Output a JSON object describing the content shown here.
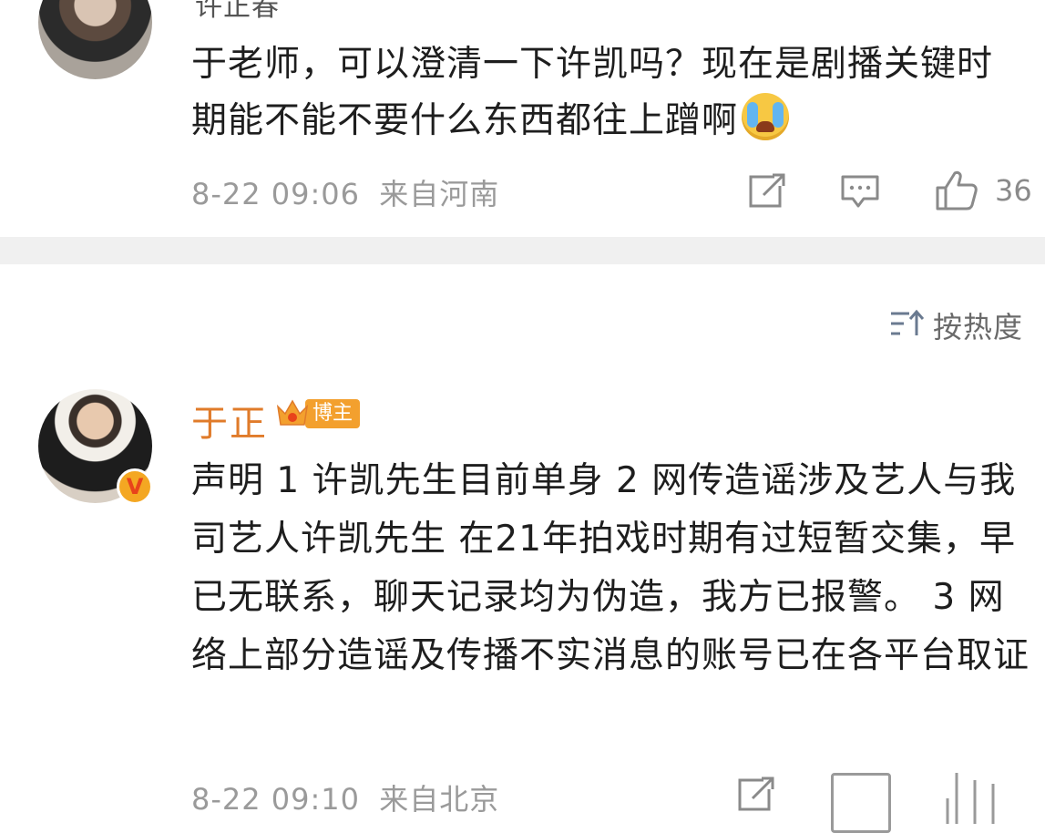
{
  "comment1": {
    "username": "许正春",
    "text": "于老师，可以澄清一下许凯吗？现在是剧播关键时期能不能不要什么东西都往上蹭啊",
    "emoji": "crying-face-icon",
    "time": "8-22 09:06",
    "location": "来自河南",
    "likes": "36"
  },
  "sort": {
    "label": "按热度"
  },
  "comment2": {
    "username": "于正",
    "badge": "博主",
    "verified_mark": "V",
    "text": "声明 1 许凯先生目前单身 2 网传造谣涉及艺人与我司艺人许凯先生 在21年拍戏时期有过短暂交集，早已无联系，聊天记录均为伪造，我方已报警。 3 网络上部分造谣及传播不实消息的账号已在各平台取证",
    "time": "8-22 09:10",
    "location": "来自北京"
  },
  "colors": {
    "name_orange": "#e07b2a",
    "badge_orange": "#f3a02e",
    "meta_gray": "#9a9a9a",
    "divider": "#f0f0f0"
  }
}
